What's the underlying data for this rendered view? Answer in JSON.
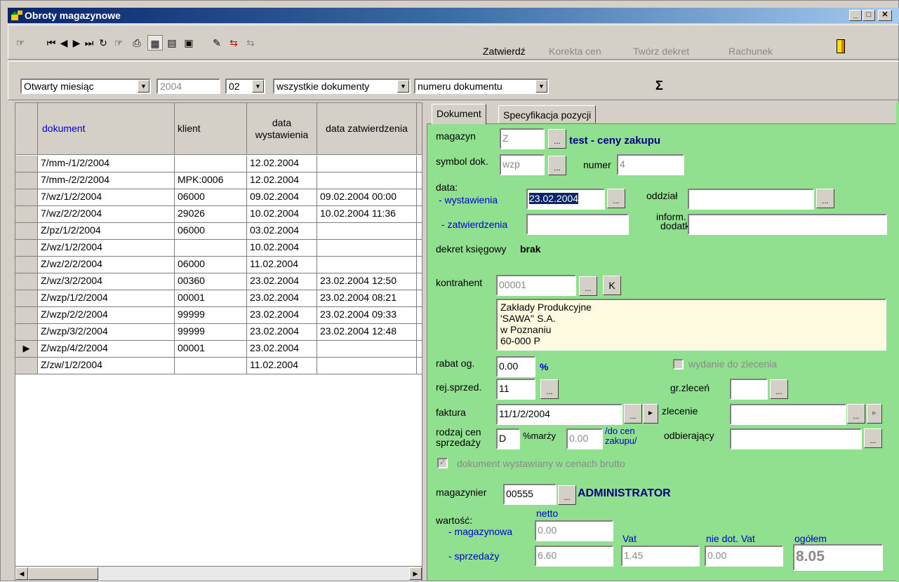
{
  "window": {
    "title": "Obroty magazynowe"
  },
  "toolbar": {
    "actions": [
      "Zatwierdź",
      "Korekta cen",
      "Twórz dekret",
      "Rachunek"
    ],
    "sigma": "Σ"
  },
  "filters": {
    "period": "Otwarty miesiąc",
    "year": "2004",
    "month": "02",
    "doc_type": "wszystkie dokumenty",
    "sort": "numeru dokumentu"
  },
  "grid": {
    "columns": [
      "dokument",
      "klient",
      "data wystawienia",
      "data zatwierdzenia"
    ],
    "rows": [
      {
        "dokument": "7/mm-/1/2/2004",
        "klient": "",
        "wyst": "12.02.2004",
        "zatw": ""
      },
      {
        "dokument": "7/mm-/2/2/2004",
        "klient": "MPK:0006",
        "wyst": "12.02.2004",
        "zatw": ""
      },
      {
        "dokument": "7/wz/1/2/2004",
        "klient": "06000",
        "wyst": "09.02.2004",
        "zatw": "09.02.2004 00:00"
      },
      {
        "dokument": "7/wz/2/2/2004",
        "klient": "29026",
        "wyst": "10.02.2004",
        "zatw": "10.02.2004 11:36"
      },
      {
        "dokument": "Z/pz/1/2/2004",
        "klient": "06000",
        "wyst": "03.02.2004",
        "zatw": ""
      },
      {
        "dokument": "Z/wz/1/2/2004",
        "klient": "",
        "wyst": "10.02.2004",
        "zatw": ""
      },
      {
        "dokument": "Z/wz/2/2/2004",
        "klient": "06000",
        "wyst": "11.02.2004",
        "zatw": ""
      },
      {
        "dokument": "Z/wz/3/2/2004",
        "klient": "00360",
        "wyst": "23.02.2004",
        "zatw": "23.02.2004 12:50"
      },
      {
        "dokument": "Z/wzp/1/2/2004",
        "klient": "00001",
        "wyst": "23.02.2004",
        "zatw": "23.02.2004 08:21"
      },
      {
        "dokument": "Z/wzp/2/2/2004",
        "klient": "99999",
        "wyst": "23.02.2004",
        "zatw": "23.02.2004 09:33"
      },
      {
        "dokument": "Z/wzp/3/2/2004",
        "klient": "99999",
        "wyst": "23.02.2004",
        "zatw": "23.02.2004 12:48"
      },
      {
        "dokument": "Z/wzp/4/2/2004",
        "klient": "00001",
        "wyst": "23.02.2004",
        "zatw": ""
      },
      {
        "dokument": "Z/zw/1/2/2004",
        "klient": "",
        "wyst": "11.02.2004",
        "zatw": ""
      }
    ],
    "current_row_marker": "▶"
  },
  "tabs": [
    "Dokument",
    "Specyfikacja pozycji"
  ],
  "form": {
    "magazyn_label": "magazyn",
    "magazyn": "Z",
    "magazyn_name": "test - ceny zakupu",
    "symbol_label": "symbol dok.",
    "symbol": "wzp",
    "numer_label": "numer",
    "numer": "4",
    "data_label": "data:",
    "wyst_label": "- wystawienia",
    "wyst": "23.02.2004",
    "zatw_label": "- zatwierdzenia",
    "zatw": "",
    "oddzial_label": "oddział",
    "oddzial": "",
    "inform_label1": "inform.",
    "inform_label2": "dodatk.",
    "inform": "",
    "dekret_label": "dekret księgowy",
    "dekret_value": "brak",
    "kontrahent_label": "kontrahent",
    "kontrahent": "00001",
    "k_button": "K",
    "address": [
      "Zakłady Produkcyjne",
      "'SAWA'' S.A.",
      "w Poznaniu",
      "60-000 P"
    ],
    "rabat_label": "rabat og.",
    "rabat": "0.00",
    "percent": "%",
    "wydanie_label": "wydanie do zlecenia",
    "rej_label": "rej.sprzed.",
    "rej": "11",
    "grzlecen_label": "gr.zleceń",
    "grzlecen": "",
    "faktura_label": "faktura",
    "faktura": "11/1/2/2004",
    "zlecenie_label": "zlecenie",
    "zlecenie": "",
    "rodzaj_label1": "rodzaj cen",
    "rodzaj_label2": "sprzedaży",
    "rodzaj": "D",
    "marza_label": "%marży",
    "marza": "0.00",
    "docen_label1": "/do cen",
    "docen_label2": "zakupu/",
    "odbierajacy_label": "odbierający",
    "odbierajacy": "",
    "brutto_label": "dokument wystawiany w cenach brutto",
    "magazynier_label": "magazynier",
    "magazynier": "00555",
    "magazynier_name": "ADMINISTRATOR",
    "wartosc_label": "wartość:",
    "netto_label": "netto",
    "mag_label": "- magazynowa",
    "mag_val": "0.00",
    "sprz_label": "- sprzedaży",
    "sprz_val": "6.60",
    "vat_label": "Vat",
    "vat_val": "1.45",
    "niedot_label": "nie dot. Vat",
    "niedot_val": "0.00",
    "ogolem_label": "ogółem",
    "ogolem_val": "8.05"
  },
  "colors": {
    "panel": "#90e090",
    "title_from": "#0a246a",
    "title_to": "#a6caf0",
    "address_bg": "#fffbe0"
  }
}
